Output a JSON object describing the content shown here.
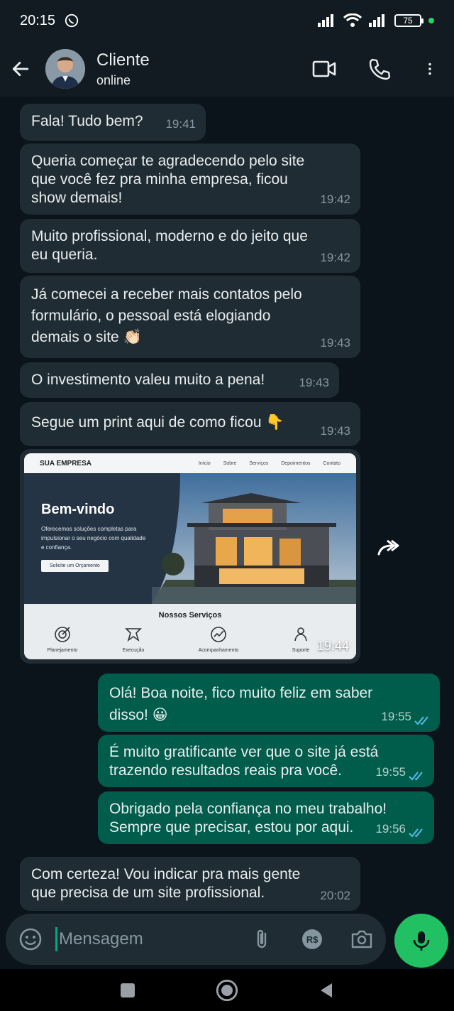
{
  "status_bar": {
    "time": "20:15",
    "battery": "75"
  },
  "header": {
    "contact_name": "Cliente",
    "contact_status": "online"
  },
  "messages": [
    {
      "text": "Fala! Tudo bem?",
      "time": "19:41"
    },
    {
      "text": "Queria começar te agradecendo pelo site que você fez pra minha empresa, ficou show demais!",
      "time": "19:42"
    },
    {
      "text": "Muito profissional, moderno e do jeito que eu queria.",
      "time": "19:42"
    },
    {
      "text": "Já comecei a receber mais contatos pelo formulário, o pessoal está elogiando demais o site 👏🏻",
      "time": "19:43"
    },
    {
      "text": "O investimento valeu muito a pena!",
      "time": "19:43"
    },
    {
      "text": "Segue um print aqui de como ficou 👇",
      "time": "19:43"
    },
    {
      "text": "Olá! Boa noite, fico muito feliz em saber disso! 😀",
      "time": "19:55"
    },
    {
      "text": "É muito gratificante ver que o site já está trazendo resultados reais pra você.",
      "time": "19:55"
    },
    {
      "text": "Obrigado pela confiança no meu trabalho! Sempre que precisar, estou por aqui.",
      "time": "19:56"
    },
    {
      "text": "Com certeza! Vou indicar pra mais gente que precisa de um site profissional.",
      "time": "20:02"
    }
  ],
  "image_message": {
    "time": "19:44",
    "site": {
      "brand": "SUA EMPRESA",
      "nav_links": [
        "Início",
        "Sobre",
        "Serviços",
        "Depoimentos",
        "Contato"
      ],
      "hero_title": "Bem-vindo",
      "hero_subtitle": "Oferecemos soluções completas para impulsionar o seu negócio com qualidade e confiança.",
      "hero_button": "Solicite um Orçamento",
      "services_title": "Nossos Serviços",
      "services": [
        "Planejamento",
        "Execução",
        "Acompanhamento",
        "Suporte"
      ]
    }
  },
  "input": {
    "placeholder": "Mensagem"
  },
  "colors": {
    "incoming": "#202c33",
    "outgoing": "#005c4b",
    "accent": "#21c063",
    "read_ticks": "#53bdeb"
  }
}
